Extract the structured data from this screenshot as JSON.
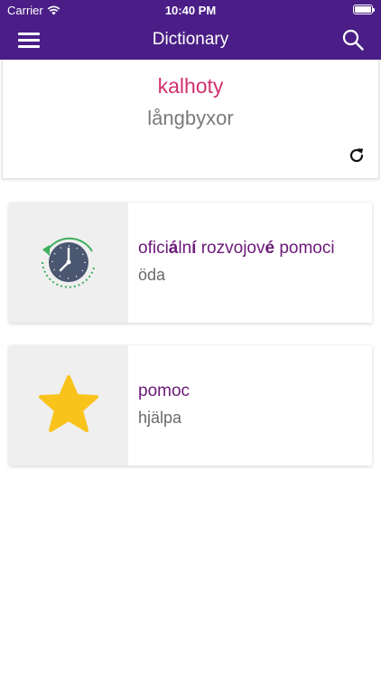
{
  "status_bar": {
    "carrier": "Carrier",
    "time": "10:40 PM"
  },
  "nav": {
    "title": "Dictionary",
    "menu_icon": "hamburger-menu-icon",
    "search_icon": "search-icon"
  },
  "word_card": {
    "word": "kalhoty",
    "translation": "långbyxor",
    "refresh_icon": "refresh-icon"
  },
  "history_card": {
    "icon": "history-clock-icon",
    "title_parts": [
      "ofici",
      "á",
      "ln",
      "í",
      " rozvojov",
      "é",
      " pomoci"
    ],
    "subtitle": "öda"
  },
  "favorites_card": {
    "icon": "star-icon",
    "title": "pomoc",
    "subtitle": "hjälpa"
  },
  "colors": {
    "header": "#4a1e86",
    "word": "#d2316e",
    "card_title": "#6b1a78",
    "star": "#f9c31c",
    "clock": "#4b5771",
    "clock_arrow": "#3fae5e"
  }
}
